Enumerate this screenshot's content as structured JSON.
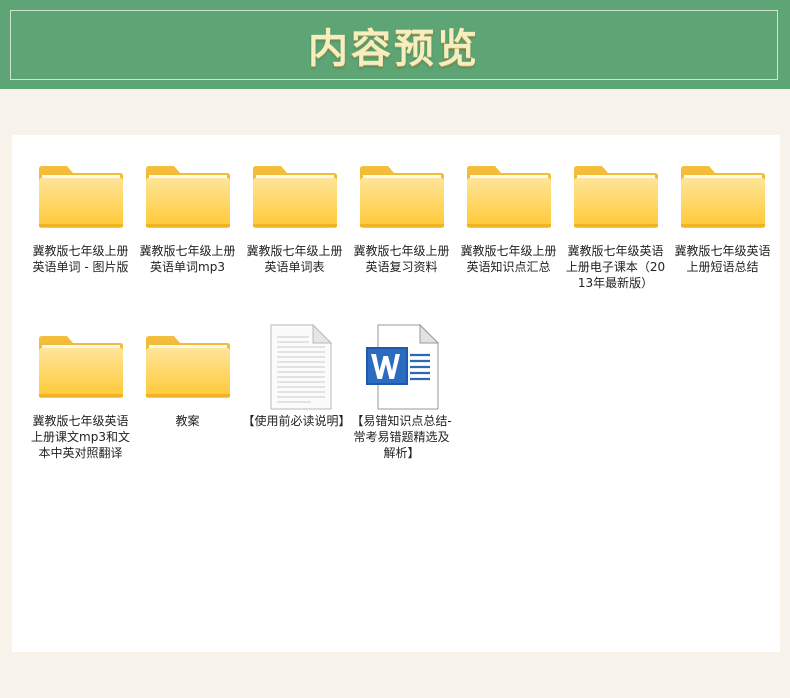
{
  "header": {
    "title": "内容预览"
  },
  "files": [
    {
      "type": "folder",
      "name": "冀教版七年级上册英语单词 - 图片版",
      "icon": "folder-icon"
    },
    {
      "type": "folder",
      "name": "冀教版七年级上册英语单词mp3",
      "icon": "folder-icon"
    },
    {
      "type": "folder",
      "name": "冀教版七年级上册英语单词表",
      "icon": "folder-icon"
    },
    {
      "type": "folder",
      "name": "冀教版七年级上册英语复习资料",
      "icon": "folder-icon"
    },
    {
      "type": "folder",
      "name": "冀教版七年级上册英语知识点汇总",
      "icon": "folder-icon"
    },
    {
      "type": "folder",
      "name": "冀教版七年级英语上册电子课本（2013年最新版）",
      "icon": "folder-icon"
    },
    {
      "type": "folder",
      "name": "冀教版七年级英语上册短语总结",
      "icon": "folder-icon"
    },
    {
      "type": "folder",
      "name": "冀教版七年级英语上册课文mp3和文本中英对照翻译",
      "icon": "folder-icon"
    },
    {
      "type": "folder",
      "name": "教案",
      "icon": "folder-icon"
    },
    {
      "type": "txt",
      "name": "【使用前必读说明】",
      "icon": "text-document-icon"
    },
    {
      "type": "word",
      "name": "【易错知识点总结-常考易错题精选及解析】",
      "icon": "word-document-icon"
    }
  ]
}
